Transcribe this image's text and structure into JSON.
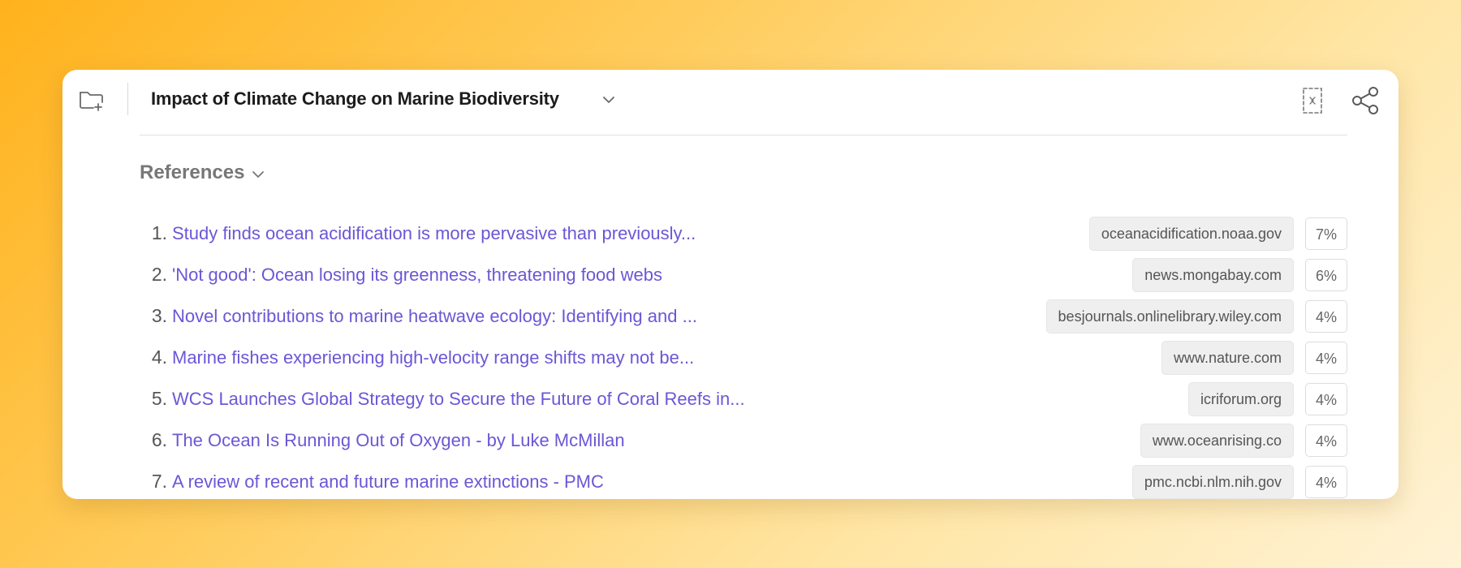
{
  "header": {
    "title": "Impact of Climate Change on Marine Biodiversity",
    "icons": {
      "folder": "folder-add-icon",
      "title_dropdown": "chevron-down-icon",
      "focus": "focus-frame-icon",
      "share": "share-icon"
    }
  },
  "references": {
    "title": "References",
    "items": [
      {
        "num": "1.",
        "title": "Study finds ocean acidification is more pervasive than previously...",
        "domain": "oceanacidification.noaa.gov",
        "percent": "7%"
      },
      {
        "num": "2.",
        "title": "'Not good': Ocean losing its greenness, threatening food webs",
        "domain": "news.mongabay.com",
        "percent": "6%"
      },
      {
        "num": "3.",
        "title": "Novel contributions to marine heatwave ecology: Identifying and ...",
        "domain": "besjournals.onlinelibrary.wiley.com",
        "percent": "4%"
      },
      {
        "num": "4.",
        "title": "Marine fishes experiencing high-velocity range shifts may not be...",
        "domain": "www.nature.com",
        "percent": "4%"
      },
      {
        "num": "5.",
        "title": "WCS Launches Global Strategy to Secure the Future of Coral Reefs in...",
        "domain": "icriforum.org",
        "percent": "4%"
      },
      {
        "num": "6.",
        "title": "The Ocean Is Running Out of Oxygen - by Luke McMillan",
        "domain": "www.oceanrising.co",
        "percent": "4%"
      },
      {
        "num": "7.",
        "title": "A review of recent and future marine extinctions - PMC",
        "domain": "pmc.ncbi.nlm.nih.gov",
        "percent": "4%"
      }
    ]
  },
  "colors": {
    "link": "#6b57d6",
    "background_gradient_start": "#ffb21c",
    "background_gradient_end": "#fff3d6"
  }
}
